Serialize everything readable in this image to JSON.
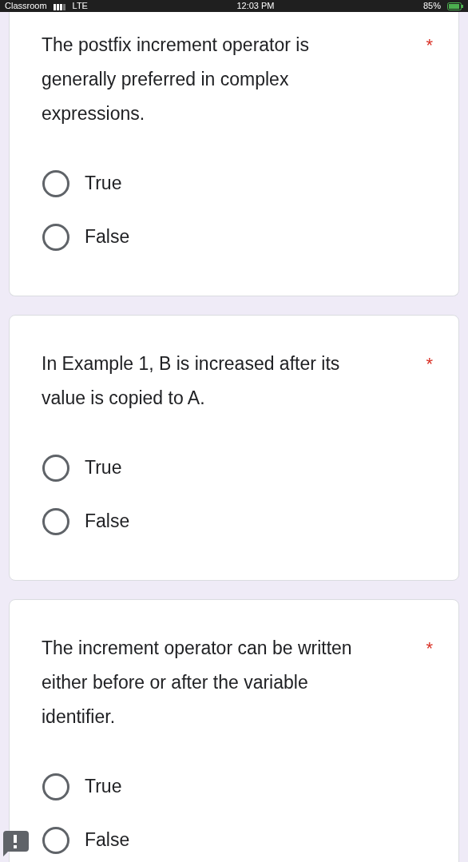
{
  "status_bar": {
    "carrier": "Classroom",
    "network": "LTE",
    "time": "12:03 PM",
    "battery": "85%"
  },
  "questions": [
    {
      "text": "The postfix increment operator is generally preferred in complex expressions.",
      "required_mark": "*",
      "options": [
        {
          "label": "True",
          "selected": false
        },
        {
          "label": "False",
          "selected": false
        }
      ]
    },
    {
      "text": "In Example 1, B is increased after its value is copied to A.",
      "required_mark": "*",
      "options": [
        {
          "label": "True",
          "selected": false
        },
        {
          "label": "False",
          "selected": false
        }
      ]
    },
    {
      "text": "The increment operator can be written either before or after the variable identifier.",
      "required_mark": "*",
      "options": [
        {
          "label": "True",
          "selected": false
        },
        {
          "label": "False",
          "selected": false
        }
      ]
    }
  ]
}
